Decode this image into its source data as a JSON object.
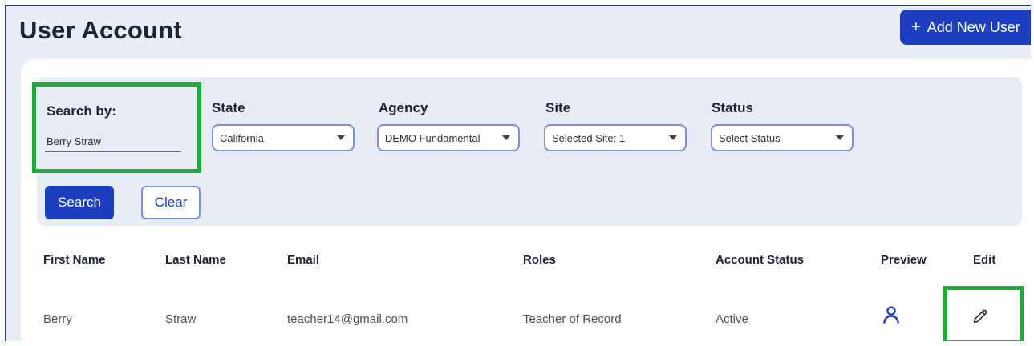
{
  "header": {
    "title": "User Account",
    "add_button_label": "Add New User",
    "add_button_icon": "+"
  },
  "filters": {
    "search": {
      "label": "Search by:",
      "value": "Berry Straw"
    },
    "state": {
      "label": "State",
      "value": "California"
    },
    "agency": {
      "label": "Agency",
      "value": "DEMO Fundamental"
    },
    "site": {
      "label": "Site",
      "value": "Selected Site: 1"
    },
    "status": {
      "label": "Status",
      "value": "Select Status"
    },
    "search_button": "Search",
    "clear_button": "Clear"
  },
  "table": {
    "columns": [
      "First Name",
      "Last Name",
      "Email",
      "Roles",
      "Account Status",
      "Preview",
      "Edit"
    ],
    "rows": [
      {
        "first_name": "Berry",
        "last_name": "Straw",
        "email": "teacher14@gmail.com",
        "role": "Teacher of Record",
        "status": "Active",
        "preview_icon": "user-icon",
        "edit_icon": "pencil-icon"
      }
    ]
  },
  "colors": {
    "primary": "#1d3fbf",
    "highlight": "#1faa3a",
    "page_bg": "#e9eef6",
    "panel_bg": "#e7ecf5",
    "select_border": "#7f8fd6"
  }
}
